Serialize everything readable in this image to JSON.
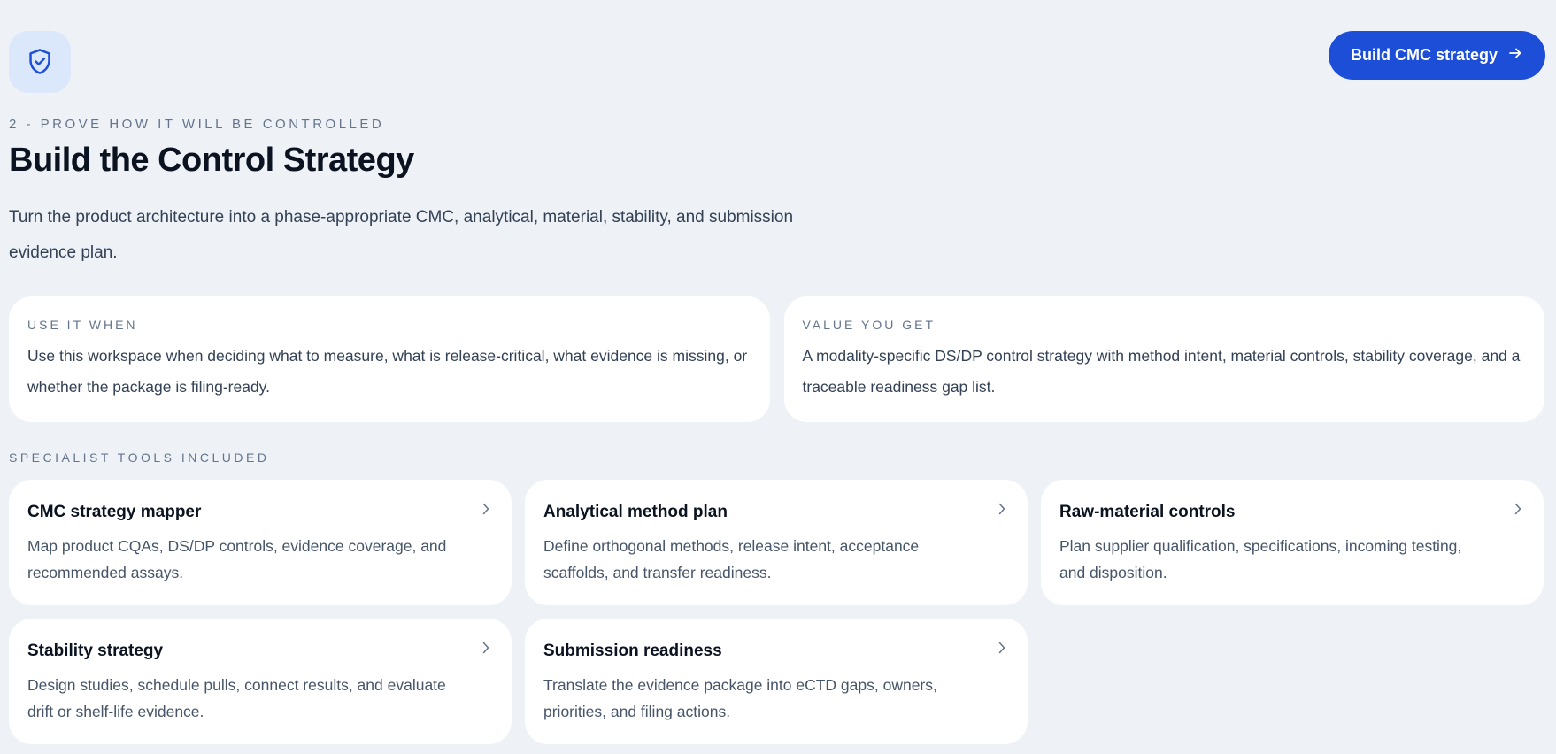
{
  "header": {
    "icon": "shield-check-icon",
    "cta_label": "Build CMC strategy",
    "cta_icon": "arrow-right-icon"
  },
  "hero": {
    "eyebrow": "2 - PROVE HOW IT WILL BE CONTROLLED",
    "title": "Build the Control Strategy",
    "description": "Turn the product architecture into a phase-appropriate CMC, analytical, material, stability, and submission evidence plan."
  },
  "info_cards": [
    {
      "label": "USE IT WHEN",
      "text": "Use this workspace when deciding what to measure, what is release-critical, what evidence is missing, or whether the package is filing-ready."
    },
    {
      "label": "VALUE YOU GET",
      "text": "A modality-specific DS/DP control strategy with method intent, material controls, stability coverage, and a traceable readiness gap list."
    }
  ],
  "tools": {
    "section_label": "SPECIALIST TOOLS INCLUDED",
    "items": [
      {
        "title": "CMC strategy mapper",
        "description": "Map product CQAs, DS/DP controls, evidence coverage, and recommended assays."
      },
      {
        "title": "Analytical method plan",
        "description": "Define orthogonal methods, release intent, acceptance scaffolds, and transfer readiness."
      },
      {
        "title": "Raw-material controls",
        "description": "Plan supplier qualification, specifications, incoming testing, and disposition."
      },
      {
        "title": "Stability strategy",
        "description": "Design studies, schedule pulls, connect results, and evaluate drift or shelf-life evidence."
      },
      {
        "title": "Submission readiness",
        "description": "Translate the evidence package into eCTD gaps, owners, priorities, and filing actions."
      }
    ]
  },
  "colors": {
    "background": "#eef2f7",
    "accent": "#1d4ed8",
    "badge_bg": "#dbe7fb",
    "card_bg": "#ffffff",
    "muted_text": "#64748b"
  }
}
